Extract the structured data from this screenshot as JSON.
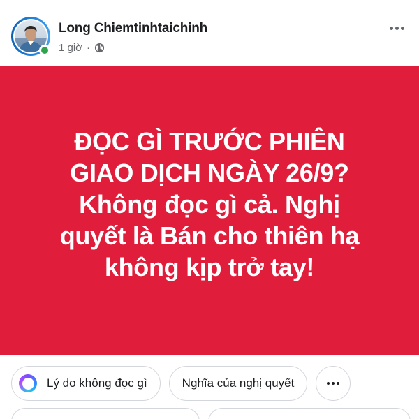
{
  "post": {
    "author_name": "Long Chiemtinhtaichinh",
    "timestamp": "1 giờ",
    "separator": "·",
    "audience_icon": "globe-icon",
    "more_icon": "more-horizontal-icon",
    "online": true
  },
  "card": {
    "background_color": "#e11d3c",
    "text_color": "#ffffff",
    "lines": [
      "ĐỌC GÌ TRƯỚC PHIÊN",
      "GIAO DỊCH NGÀY 26/9?",
      "Không đọc gì cả. Nghị",
      "quyết là Bán cho thiên hạ",
      "không kịp trở tay!"
    ]
  },
  "suggestions": {
    "chips": [
      {
        "label": "Lý do không đọc gì",
        "icon": "meta-ai-icon"
      },
      {
        "label": "Nghĩa của nghị quyết"
      }
    ],
    "more_icon": "more-horizontal-icon"
  }
}
